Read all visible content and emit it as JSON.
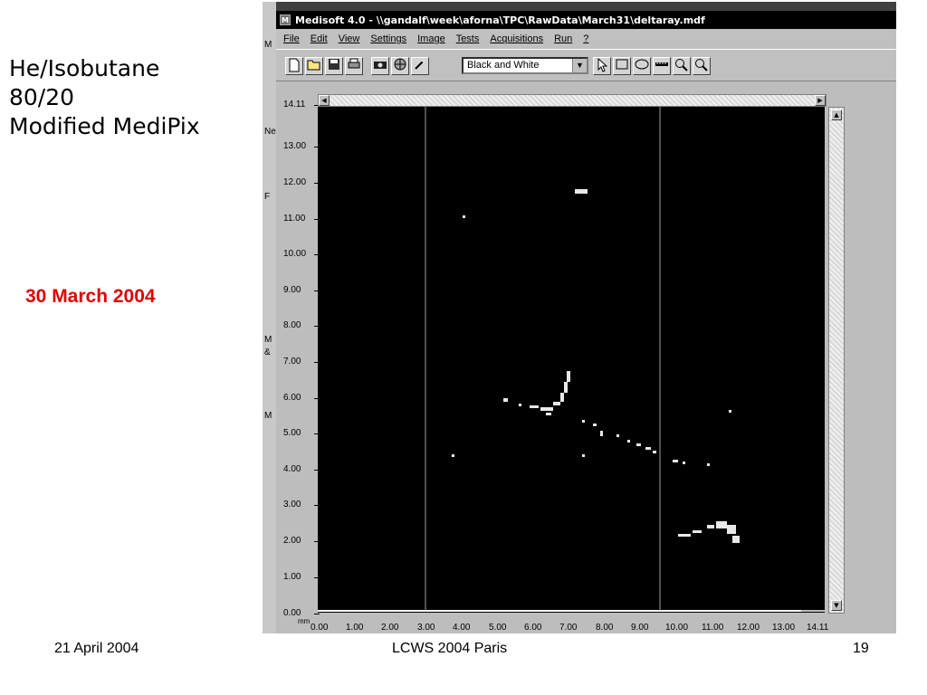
{
  "slide": {
    "title_lines": [
      "He/Isobutane",
      "80/20",
      "Modified MediPix"
    ],
    "date_red": "30 March 2004",
    "footer": {
      "left": "21 April 2004",
      "center": "LCWS 2004 Paris",
      "right": "19"
    }
  },
  "window": {
    "title": "Medisoft 4.0 - \\\\gandalf\\week\\aforna\\TPC\\RawData\\March31\\deltaray.mdf",
    "left_strip_letters": [
      "M",
      "Ne",
      "F",
      "M",
      "&",
      "M"
    ]
  },
  "menu": {
    "items": [
      "File",
      "Edit",
      "View",
      "Settings",
      "Image",
      "Tests",
      "Acquisitions",
      "Run",
      "?"
    ]
  },
  "toolbar": {
    "palette_value": "Black and White",
    "buttons": [
      "new-icon",
      "open-icon",
      "save-icon",
      "print-icon",
      "camera-icon",
      "globe-icon",
      "wand-icon"
    ],
    "tools": [
      "pointer-icon",
      "rectangle-icon",
      "ellipse-icon",
      "ruler-icon",
      "zoom-in-icon",
      "zoom-out-icon"
    ]
  },
  "axes": {
    "y_ticks": [
      "14.11",
      "13.00",
      "12.00",
      "11.00",
      "10.00",
      "9.00",
      "8.00",
      "7.00",
      "6.00",
      "5.00",
      "4.00",
      "3.00",
      "2.00",
      "1.00",
      "0.00"
    ],
    "x_ticks": [
      "0.00",
      "1.00",
      "2.00",
      "3.00",
      "4.00",
      "5.00",
      "6.00",
      "7.00",
      "8.00",
      "9.00",
      "10.00",
      "11.00",
      "12.00",
      "13.00",
      "14.11"
    ],
    "unit": "mm"
  },
  "colors": {
    "date_red": "#e00000",
    "window_bg": "#404040",
    "image_bg": "#000000",
    "hit_pixel": "#e8e8e8"
  }
}
